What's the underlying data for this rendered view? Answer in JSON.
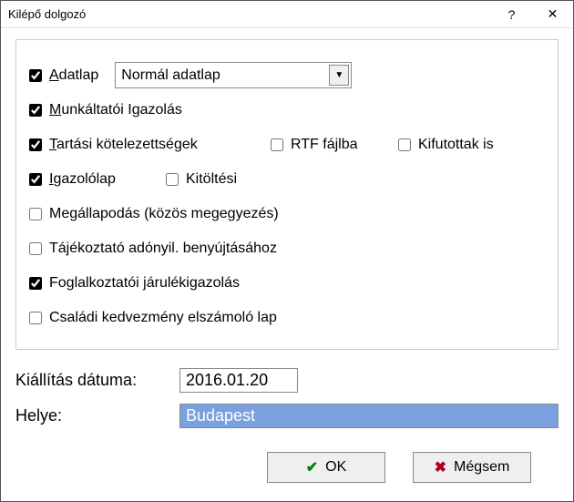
{
  "window": {
    "title": "Kilépő dolgozó"
  },
  "checks": {
    "adatlap": {
      "label_pre": "",
      "acc": "A",
      "label_post": "datlap",
      "checked": true
    },
    "munkaltatoi": {
      "acc": "M",
      "label_post": "unkáltatói Igazolás",
      "checked": true
    },
    "tartasi": {
      "acc": "T",
      "label_post": "artási kötelezettségek",
      "checked": true
    },
    "rtf": {
      "label": "RTF fájlba",
      "checked": false
    },
    "kifutottak": {
      "label": "Kifutottak is",
      "checked": false
    },
    "igazololap": {
      "acc": "I",
      "label_post": "gazolólap",
      "checked": true
    },
    "kitoltesi": {
      "label": "Kitöltési",
      "checked": false
    },
    "megallapodas": {
      "label": "Megállapodás (közös megegyezés)",
      "checked": false
    },
    "tajekoztato": {
      "label": "Tájékoztató adónyil. benyújtásához",
      "checked": false
    },
    "foglalkoztatoi": {
      "label": "Foglalkoztatói járulékigazolás",
      "checked": true
    },
    "csaladi": {
      "label": "Családi kedvezmény elszámoló lap",
      "checked": false
    }
  },
  "adatlap_select": {
    "value": "Normál adatlap",
    "options": [
      "Normál adatlap"
    ]
  },
  "fields": {
    "date_label": "Kiállítás dátuma:",
    "date_value": "2016.01.20",
    "place_label": "Helye:",
    "place_value": "Budapest"
  },
  "buttons": {
    "ok": "OK",
    "cancel": "Mégsem"
  }
}
